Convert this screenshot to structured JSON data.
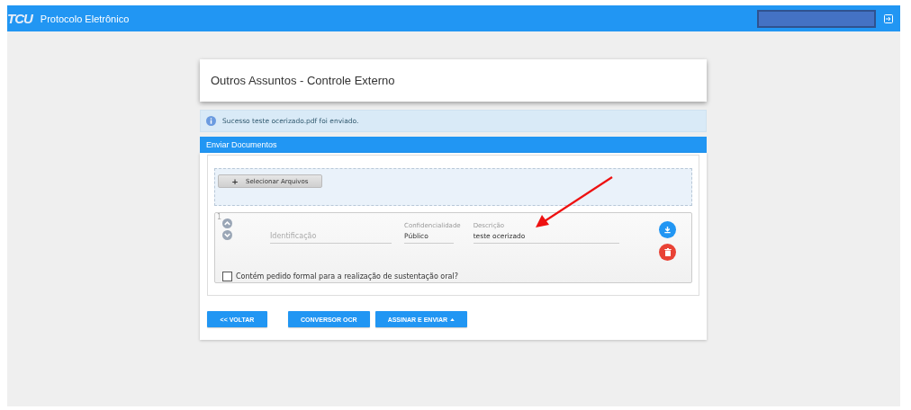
{
  "top_bar": {
    "logo": "TCU",
    "title": "Protocolo Eletrônico"
  },
  "page_title": "Outros Assuntos - Controle Externo",
  "alert": {
    "message": "Sucesso teste ocerizado.pdf foi enviado."
  },
  "panel": {
    "title": "Enviar Documentos",
    "select_button": {
      "icon": "+",
      "label": "Selecionar Arquivos"
    },
    "file": {
      "index": "1",
      "identification": {
        "placeholder": "Identificação"
      },
      "confidentiality": {
        "label": "Confidencialidade",
        "value": "Público"
      },
      "description": {
        "label": "Descrição",
        "value": "teste ocerizado"
      },
      "oral_request": {
        "label": "Contém pedido formal para a realização de sustentação oral?",
        "checked": false
      }
    }
  },
  "buttons": [
    {
      "label": "<< VOLTAR",
      "caret": false
    },
    {
      "label": "CONVERSOR OCR",
      "caret": false
    },
    {
      "label": "ASSINAR E ENVIAR",
      "caret": true
    }
  ]
}
